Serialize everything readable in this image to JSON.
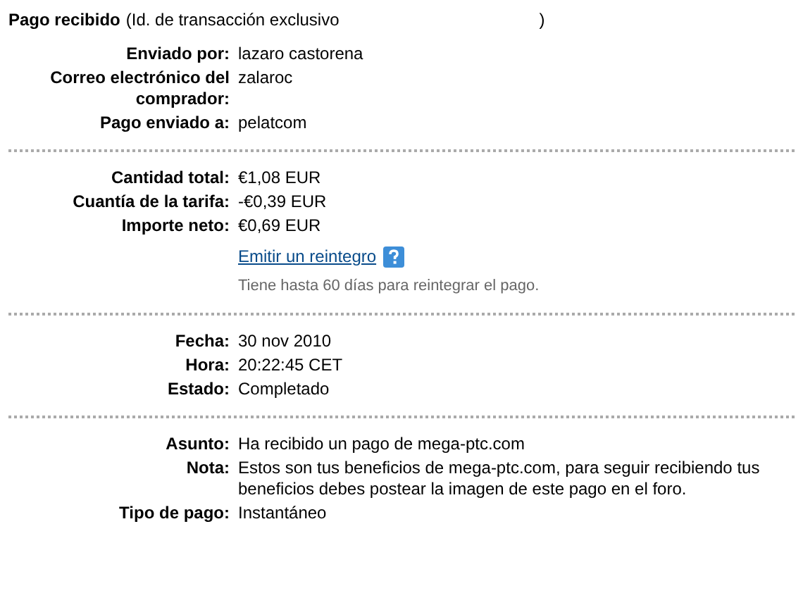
{
  "header": {
    "title": "Pago recibido",
    "detail_open": "(Id. de transacción exclusivo",
    "detail_close": ")"
  },
  "sections": [
    {
      "rows": [
        {
          "kind": "field",
          "label": "Enviado por:",
          "value": "lazaro castorena"
        },
        {
          "kind": "field",
          "label": "Correo electrónico del comprador:",
          "value": "zalaroc"
        },
        {
          "kind": "field",
          "label": "Pago enviado a:",
          "value": "pelatcom"
        }
      ]
    },
    {
      "rows": [
        {
          "kind": "field",
          "label": "Cantidad total:",
          "value": "€1,08 EUR"
        },
        {
          "kind": "field",
          "label": "Cuantía de la tarifa:",
          "value": "-€0,39 EUR"
        },
        {
          "kind": "field",
          "label": "Importe neto:",
          "value": "€0,69 EUR"
        },
        {
          "kind": "link",
          "value": "Emitir un reintegro"
        },
        {
          "kind": "hint",
          "value": "Tiene hasta 60 días para reintegrar el pago."
        }
      ]
    },
    {
      "rows": [
        {
          "kind": "field",
          "label": "Fecha:",
          "value": "30 nov 2010"
        },
        {
          "kind": "field",
          "label": "Hora:",
          "value": "20:22:45 CET"
        },
        {
          "kind": "field",
          "label": "Estado:",
          "value": "Completado"
        }
      ]
    },
    {
      "rows": [
        {
          "kind": "field",
          "label": "Asunto:",
          "value": "Ha recibido un pago de mega-ptc.com"
        },
        {
          "kind": "field",
          "label": "Nota:",
          "value": "Estos son tus beneficios de mega-ptc.com, para seguir recibiendo tus beneficios debes postear la imagen de este pago en el foro."
        },
        {
          "kind": "field",
          "label": "Tipo de pago:",
          "value": "Instantáneo"
        }
      ]
    }
  ]
}
